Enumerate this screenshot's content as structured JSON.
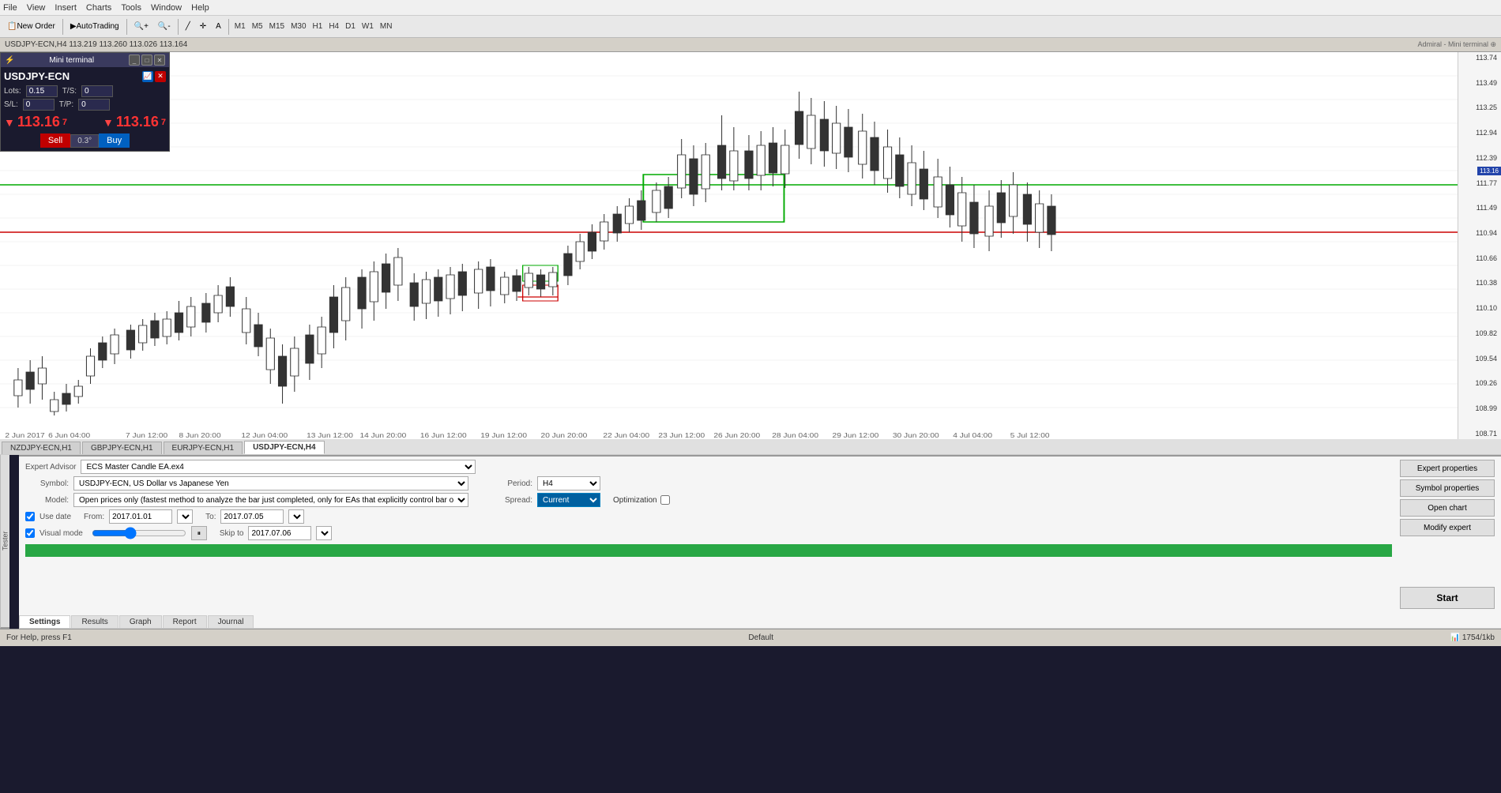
{
  "menubar": {
    "items": [
      "File",
      "View",
      "Insert",
      "Charts",
      "Tools",
      "Window",
      "Help"
    ]
  },
  "toolbar": {
    "new_order": "New Order",
    "autotrading": "AutoTrading",
    "timeframes": [
      "M1",
      "M5",
      "M15",
      "M30",
      "H1",
      "H4",
      "D1",
      "W1",
      "MN"
    ]
  },
  "chart_title": "USDJPY-ECN,H4  113.219  113.260  113.026  113.164",
  "admiral_label": "Admiral - Mini terminal ⊕",
  "mini_terminal": {
    "title": "Mini terminal",
    "symbol": "USDJPY-ECN",
    "lots_label": "Lots:",
    "lots_value": "0.15",
    "ts_label": "T/S:",
    "ts_value": "0",
    "sl_label": "S/L:",
    "sl_value": "0",
    "tp_label": "T/P:",
    "tp_value": "0",
    "price_sell": "113.16↓",
    "price_buy": "113.16↓",
    "sell_label": "Sell",
    "buy_label": "Buy",
    "spread": "0.3°"
  },
  "tabs": [
    {
      "label": "NZDJPY-ECN,H1",
      "active": false
    },
    {
      "label": "GBPJPY-ECN,H1",
      "active": false
    },
    {
      "label": "EURJPY-ECN,H1",
      "active": false
    },
    {
      "label": "USDJPY-ECN,H4",
      "active": true
    }
  ],
  "tester": {
    "header": "Tester",
    "expert_label": "Expert Advisor",
    "expert_value": "ECS Master Candle EA.ex4",
    "symbol_label": "Symbol:",
    "symbol_value": "USDJPY-ECN, US Dollar vs Japanese Yen",
    "model_label": "Model:",
    "model_value": "Open prices only (fastest method to analyze the bar just completed, only for EAs that explicitly control bar opening)",
    "period_label": "Period:",
    "period_value": "H4",
    "spread_label": "Spread:",
    "spread_value": "Current",
    "use_date_label": "Use date",
    "from_label": "From:",
    "from_value": "2017.01.01",
    "to_label": "To:",
    "to_value": "2017.07.05",
    "optimization_label": "Optimization",
    "visual_mode_label": "Visual mode",
    "skip_to_label": "Skip to",
    "skip_to_value": "2017.07.06",
    "expert_properties_btn": "Expert properties",
    "symbol_properties_btn": "Symbol properties",
    "open_chart_btn": "Open chart",
    "modify_expert_btn": "Modify expert",
    "start_btn": "Start",
    "tabs": [
      "Settings",
      "Results",
      "Graph",
      "Report",
      "Journal"
    ],
    "active_tab": "Settings"
  },
  "price_axis": {
    "values": [
      "113.74",
      "113.49",
      "113.25",
      "112.94",
      "112.39",
      "111.77",
      "111.49",
      "110.94",
      "110.66",
      "110.38",
      "110.10",
      "109.82",
      "109.54",
      "109.26",
      "108.99",
      "108.71"
    ]
  },
  "status_bar": {
    "left": "For Help, press F1",
    "center": "Default",
    "right": "1754/1kb"
  }
}
